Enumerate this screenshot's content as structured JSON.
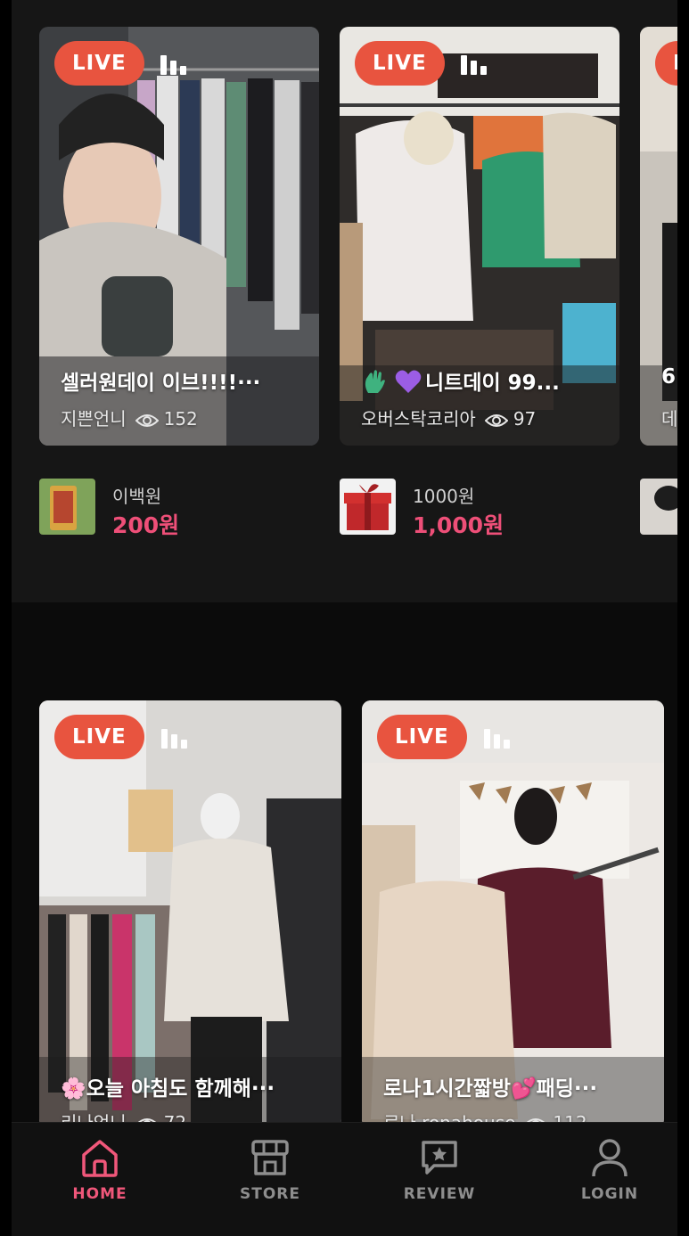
{
  "colors": {
    "accent": "#ee4f78",
    "live_badge": "#e8543f",
    "background": "#161616",
    "nav_inactive": "#8e8e8e"
  },
  "live_label": "LIVE",
  "row1": {
    "cards": [
      {
        "title": "셀러원데이 이브!!!!···",
        "host": "지쁜언니",
        "views": "152"
      },
      {
        "title": "니트데이 99...",
        "title_emoji": [
          "waving-hand",
          "purple-heart"
        ],
        "host": "오버스탁코리아",
        "views": "97"
      },
      {
        "title": "6",
        "host": "데"
      }
    ],
    "products": [
      {
        "name": "이백원",
        "price": "200원"
      },
      {
        "name": "1000원",
        "price": "1,000원"
      }
    ]
  },
  "row2": {
    "cards": [
      {
        "title": "🌸오늘 아침도 함께해···",
        "host": "리나언니",
        "views": "72"
      },
      {
        "title": "로나1시간짧방💕패딩···",
        "host": "로나 ronahouse",
        "views": "112"
      }
    ]
  },
  "nav": {
    "items": [
      {
        "label": "HOME",
        "icon": "home-icon",
        "active": true
      },
      {
        "label": "STORE",
        "icon": "store-icon",
        "active": false
      },
      {
        "label": "REVIEW",
        "icon": "review-icon",
        "active": false
      },
      {
        "label": "LOGIN",
        "icon": "user-icon",
        "active": false
      }
    ]
  }
}
